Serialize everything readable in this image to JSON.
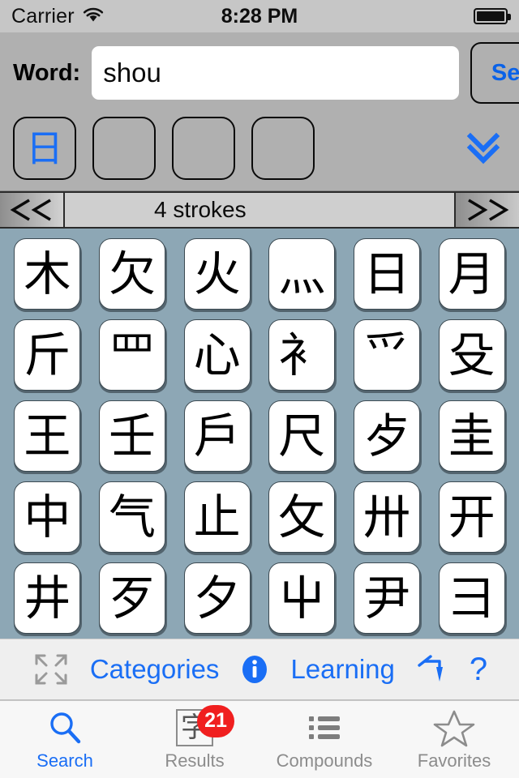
{
  "status_bar": {
    "carrier": "Carrier",
    "wifi_icon": "wifi-icon",
    "time": "8:28 PM",
    "battery_icon": "battery-full-icon"
  },
  "header": {
    "word_label": "Word:",
    "word_value": "shou",
    "word_placeholder": "",
    "search_button": "Search",
    "radical_boxes": [
      {
        "char": "日",
        "filled": true
      },
      {
        "char": "",
        "filled": false
      },
      {
        "char": "",
        "filled": false
      },
      {
        "char": "",
        "filled": false
      }
    ],
    "expand_icon": "chevron-double-down-icon",
    "accent_color": "#1a6ef5"
  },
  "stroke_nav": {
    "prev_label": "«",
    "next_label": "»",
    "stroke_text": "4 strokes"
  },
  "grid": {
    "background_color": "#8da7b5",
    "rows": [
      [
        "木",
        "欠",
        "火",
        "灬",
        "日",
        "月"
      ],
      [
        "斤",
        "罒",
        "心",
        "衤",
        "爫",
        "殳"
      ],
      [
        "王",
        "壬",
        "戶",
        "尺",
        "歺",
        "圭"
      ],
      [
        "中",
        "气",
        "止",
        "攵",
        "卅",
        "开"
      ],
      [
        "井",
        "歹",
        "夕",
        "屮",
        "尹",
        "彐"
      ]
    ]
  },
  "toolbar": {
    "expand_icon": "expand-arrows-icon",
    "categories_label": "Categories",
    "info_icon": "info-circle-icon",
    "learning_label": "Learning",
    "stroke_order_icon": "stroke-order-pen-icon",
    "help_label": "?"
  },
  "tab_bar": {
    "tabs": [
      {
        "label": "Search",
        "icon": "magnifier-icon",
        "active": true,
        "badge": ""
      },
      {
        "label": "Results",
        "icon": "character-box-icon",
        "active": false,
        "badge": "21"
      },
      {
        "label": "Compounds",
        "icon": "list-icon",
        "active": false,
        "badge": ""
      },
      {
        "label": "Favorites",
        "icon": "star-icon",
        "active": false,
        "badge": ""
      }
    ],
    "badge_color": "#f01f1f",
    "active_color": "#1a6ef5"
  }
}
